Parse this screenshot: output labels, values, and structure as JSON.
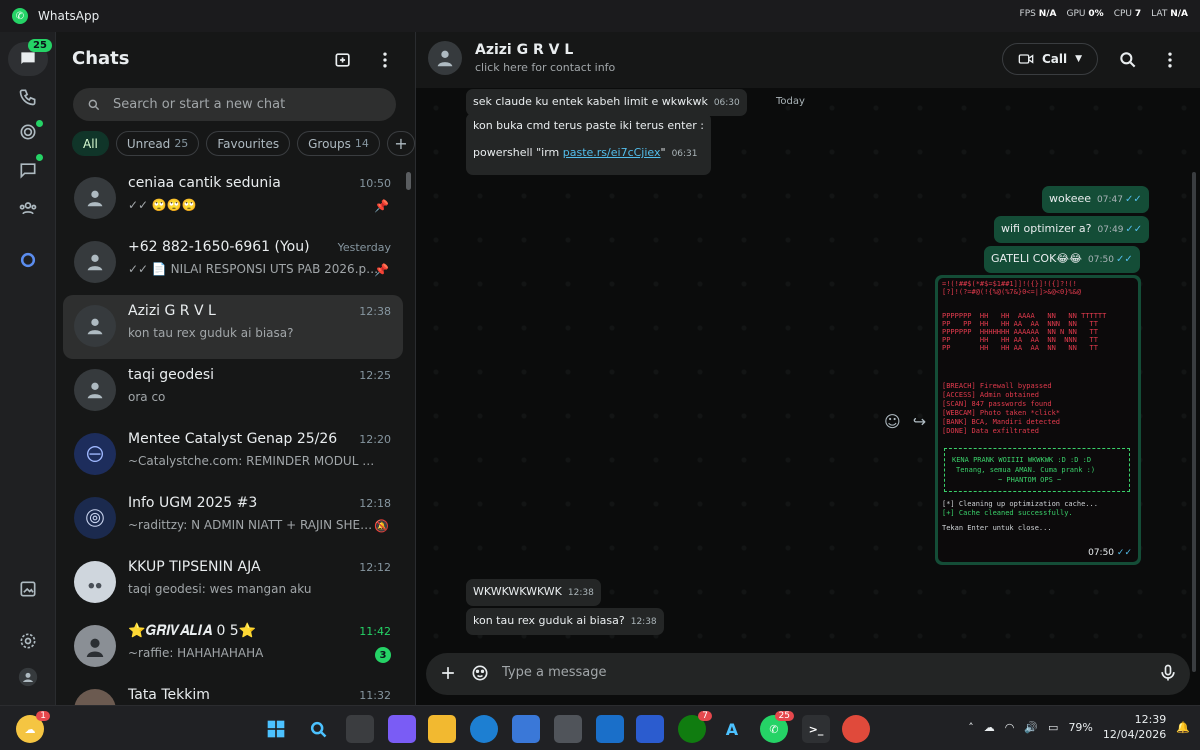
{
  "window": {
    "title": "WhatsApp"
  },
  "perf": {
    "fps_label": "FPS",
    "fps": "N/A",
    "gpu_label": "GPU",
    "gpu": "0%",
    "cpu_label": "CPU",
    "cpu": "7",
    "lat_label": "LAT",
    "lat": "N/A"
  },
  "rail": {
    "chats_badge": "25"
  },
  "chatlist": {
    "title": "Chats",
    "search_placeholder": "Search or start a new chat",
    "filters": [
      {
        "label": "All",
        "count": ""
      },
      {
        "label": "Unread",
        "count": "25"
      },
      {
        "label": "Favourites",
        "count": ""
      },
      {
        "label": "Groups",
        "count": "14"
      }
    ],
    "chats": [
      {
        "name": "ceniaa cantik sedunia",
        "time": "10:50",
        "preview": "✓✓ 🙄🙄🙄"
      },
      {
        "name": "+62 882-1650-6961 (You)",
        "time": "Yesterday",
        "preview": "✓✓ 📄 NILAI RESPONSI UTS PAB 2026.pdf •..."
      },
      {
        "name": "Azizi G R V L",
        "time": "12:38",
        "preview": "kon tau rex guduk ai biasa?"
      },
      {
        "name": "taqi geodesi",
        "time": "12:25",
        "preview": "ora co"
      },
      {
        "name": "Mentee Catalyst Genap 25/26",
        "time": "12:20",
        "preview": "~Catalystche.com: REMINDER MODUL CATAL..."
      },
      {
        "name": "Info UGM 2025 #3",
        "time": "12:18",
        "preview": "~radittzy: N ADMIN NIATT + RAJIN SHERE ..."
      },
      {
        "name": "KKUP TIPSENIN AJA",
        "time": "12:12",
        "preview": "taqi geodesi: wes mangan aku"
      },
      {
        "name": "⭐𝑮𝑹𝑰𝑽𝑨𝑳𝑰𝑨 0 5⭐",
        "time": "11:42",
        "preview": "~raffie: HAHAHAHAHA",
        "unread": "3"
      },
      {
        "name": "Tata Tekkim",
        "time": "11:32",
        "preview": ""
      }
    ]
  },
  "conversation": {
    "contact_name": "Azizi G R V L",
    "contact_info": "click here for contact info",
    "call_label": "Call",
    "day_separator": "Today",
    "messages": {
      "m1": {
        "text": "sek claude ku entek kabeh limit e wkwkwk",
        "time": "06:30"
      },
      "m2a": {
        "text": "kon buka cmd terus paste iki terus enter :"
      },
      "m2b": {
        "prefix": "powershell \"irm ",
        "link": "paste.rs/ei7cCjiex",
        "suffix": "\"",
        "time": "06:31"
      },
      "m3": {
        "text": "wokeee",
        "time": "07:47"
      },
      "m4": {
        "text": "wifi optimizer a?",
        "time": "07:49"
      },
      "m5": {
        "text": "GATELI COK😂😂",
        "time": "07:50"
      },
      "m6": {
        "time": "07:50"
      },
      "m7": {
        "text": "WKWKWKWKWK",
        "time": "12:38"
      },
      "m8": {
        "text": "kon tau rex guduk ai biasa?",
        "time": "12:38"
      }
    },
    "image_text": {
      "l1": "[BREACH] Firewall bypassed",
      "l2": "[ACCESS] Admin obtained",
      "l3": "[SCAN] 847 passwords found",
      "l4": "[WEBCAM] Photo taken *click*",
      "l5": "[BANK] BCA, Mandiri detected",
      "l6": "[DONE] Data exfiltrated",
      "b1": "KENA PRANK WOIIII WKWKWK :D :D :D",
      "b2": "Tenang, semua AMAN. Cuma prank :)",
      "b3": "~ PHANTOM OPS ~",
      "c1": "[*] Cleaning up optimization cache...",
      "c2": "[+] Cache cleaned successfully.",
      "c3": "Tekan Enter untuk close..."
    },
    "composer_placeholder": "Type a message"
  },
  "taskbar": {
    "whatsapp_badge": "25",
    "xbox_badge": "7",
    "weather_badge": "1",
    "battery": "79%",
    "time": "12:39",
    "date": "12/04/2026"
  },
  "colors": {
    "accent": "#25d366",
    "outgoing_bubble": "#144d37",
    "incoming_bubble": "#242626",
    "link": "#53bdeb"
  }
}
